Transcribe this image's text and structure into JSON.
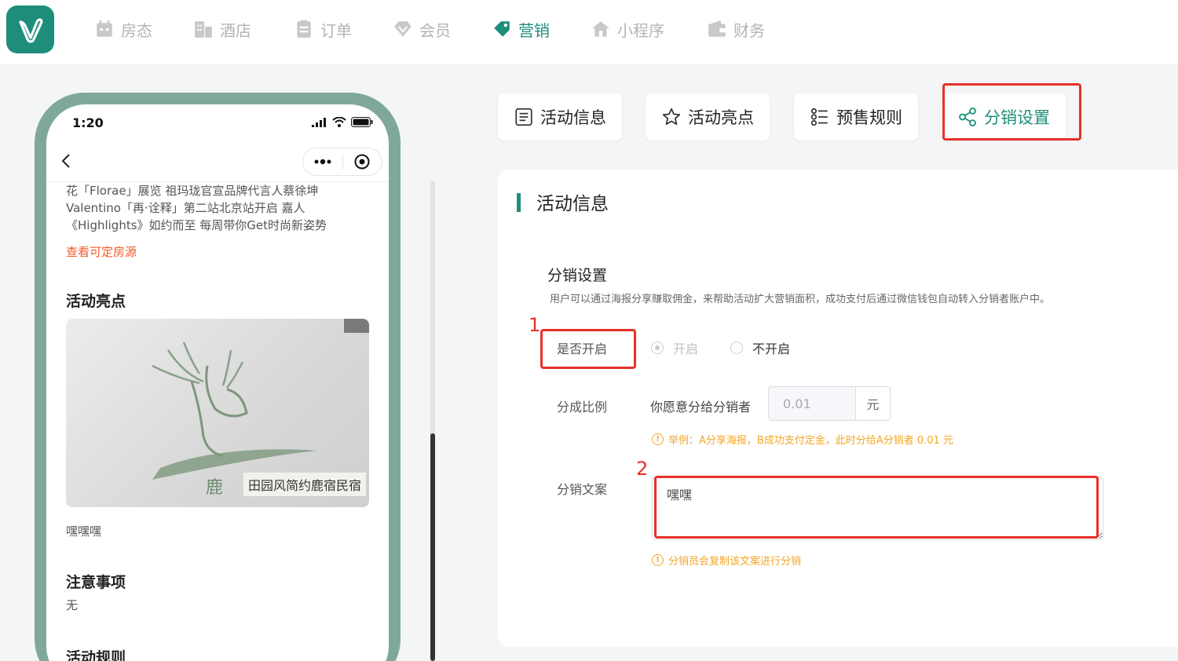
{
  "nav": {
    "items": [
      {
        "label": "房态",
        "icon": "calendar-icon"
      },
      {
        "label": "酒店",
        "icon": "building-icon"
      },
      {
        "label": "订单",
        "icon": "clipboard-icon"
      },
      {
        "label": "会员",
        "icon": "diamond-icon"
      },
      {
        "label": "营销",
        "icon": "tag-icon",
        "active": true
      },
      {
        "label": "小程序",
        "icon": "home-icon"
      },
      {
        "label": "财务",
        "icon": "wallet-icon"
      }
    ],
    "accent_color": "#1e8e7a",
    "inactive_color": "#b3b3b3"
  },
  "phone": {
    "time": "1:20",
    "description": "花「Florae」展览 祖玛珑官宣品牌代言人蔡徐坤 Valentino「再·诠释」第二站北京站开启 嘉人《Highlights》如约而至 每周带你Get时尚新姿势",
    "room_link": "查看可定房源",
    "highlights_title": "活动亮点",
    "image_caption": "田园风简约鹿宿民宿",
    "image_seal_text": "鹿",
    "highlights_text": "嘿嘿嘿",
    "notice_title": "注意事项",
    "notice_text": "无",
    "rules_title": "活动规则"
  },
  "tabs": [
    {
      "label": "活动信息",
      "icon": "document-icon"
    },
    {
      "label": "活动亮点",
      "icon": "star-icon"
    },
    {
      "label": "预售规则",
      "icon": "list-icon"
    },
    {
      "label": "分销设置",
      "icon": "share-icon",
      "active": true
    }
  ],
  "panel": {
    "title": "活动信息",
    "section_heading": "分销设置",
    "section_desc": "用户可以通过海报分享赚取佣金，来帮助活动扩大营销面积，成功支付后通过微信钱包自动转入分销者账户中。",
    "enable_label": "是否开启",
    "radio_on": "开启",
    "radio_off": "不开启",
    "ratio_label": "分成比例",
    "ratio_prefix": "你愿意分给分销者",
    "ratio_value": "0.01",
    "ratio_unit": "元",
    "ratio_hint": "举例：A分享海报，B成功支付定金，此时分给A分销者 0.01 元",
    "copy_label": "分销文案",
    "copy_value": "嘿嘿",
    "copy_hint": "分销员会复制该文案进行分销"
  },
  "annotations": {
    "marker_1": "1",
    "marker_2": "2",
    "color": "#e8302a"
  }
}
